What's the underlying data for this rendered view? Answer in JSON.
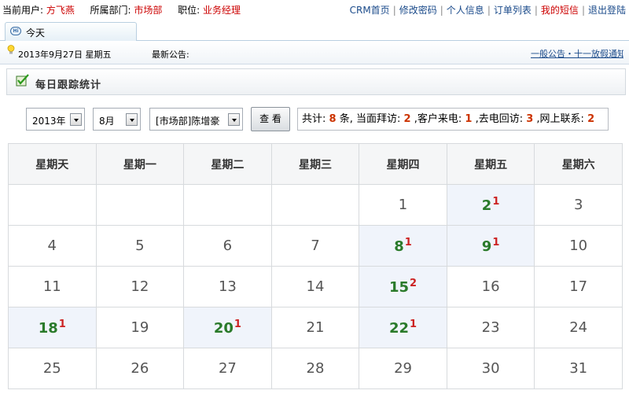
{
  "topbar": {
    "user_label": "当前用户:",
    "user_name": "方飞燕",
    "dept_label": "所属部门:",
    "dept_name": "市场部",
    "role_label": "职位:",
    "role_name": "业务经理",
    "links": [
      {
        "label": "CRM首页",
        "color": "#1a4a8a"
      },
      {
        "label": "修改密码",
        "color": "#1a4a8a"
      },
      {
        "label": "个人信息",
        "color": "#1a4a8a"
      },
      {
        "label": "订单列表",
        "color": "#1a4a8a"
      },
      {
        "label": "我的短信",
        "color": "#cc0000"
      },
      {
        "label": "退出登陆",
        "color": "#1a4a8a"
      }
    ]
  },
  "tab": {
    "label": "今天"
  },
  "infobar": {
    "date": "2013年9月27日 星期五",
    "notice_label": "最新公告:",
    "notice_link": "一般公告・十一放假通知"
  },
  "section": {
    "title": "每日跟踪统计"
  },
  "filters": {
    "year": "2013年",
    "month": "8月",
    "user": "[市场部]陈增豪",
    "view_button": "查 看"
  },
  "summary": {
    "total_label": "共计:",
    "total": "8",
    "total_unit": "条,",
    "visit_label": "当面拜访:",
    "visit": "2",
    "incoming_label": ",客户来电:",
    "incoming": "1",
    "callback_label": ",去电回访:",
    "callback": "3",
    "online_label": ",网上联系:",
    "online": "2"
  },
  "calendar": {
    "weekdays": [
      "星期天",
      "星期一",
      "星期二",
      "星期三",
      "星期四",
      "星期五",
      "星期六"
    ],
    "weeks": [
      [
        null,
        null,
        null,
        null,
        {
          "day": "1"
        },
        {
          "day": "2",
          "count": "1"
        },
        {
          "day": "3"
        }
      ],
      [
        {
          "day": "4"
        },
        {
          "day": "5"
        },
        {
          "day": "6"
        },
        {
          "day": "7"
        },
        {
          "day": "8",
          "count": "1"
        },
        {
          "day": "9",
          "count": "1"
        },
        {
          "day": "10"
        }
      ],
      [
        {
          "day": "11"
        },
        {
          "day": "12"
        },
        {
          "day": "13"
        },
        {
          "day": "14"
        },
        {
          "day": "15",
          "count": "2"
        },
        {
          "day": "16"
        },
        {
          "day": "17"
        }
      ],
      [
        {
          "day": "18",
          "count": "1"
        },
        {
          "day": "19"
        },
        {
          "day": "20",
          "count": "1"
        },
        {
          "day": "21"
        },
        {
          "day": "22",
          "count": "1"
        },
        {
          "day": "23"
        },
        {
          "day": "24"
        }
      ],
      [
        {
          "day": "25"
        },
        {
          "day": "26"
        },
        {
          "day": "27"
        },
        {
          "day": "28"
        },
        {
          "day": "29"
        },
        {
          "day": "30"
        },
        {
          "day": "31"
        }
      ]
    ]
  }
}
